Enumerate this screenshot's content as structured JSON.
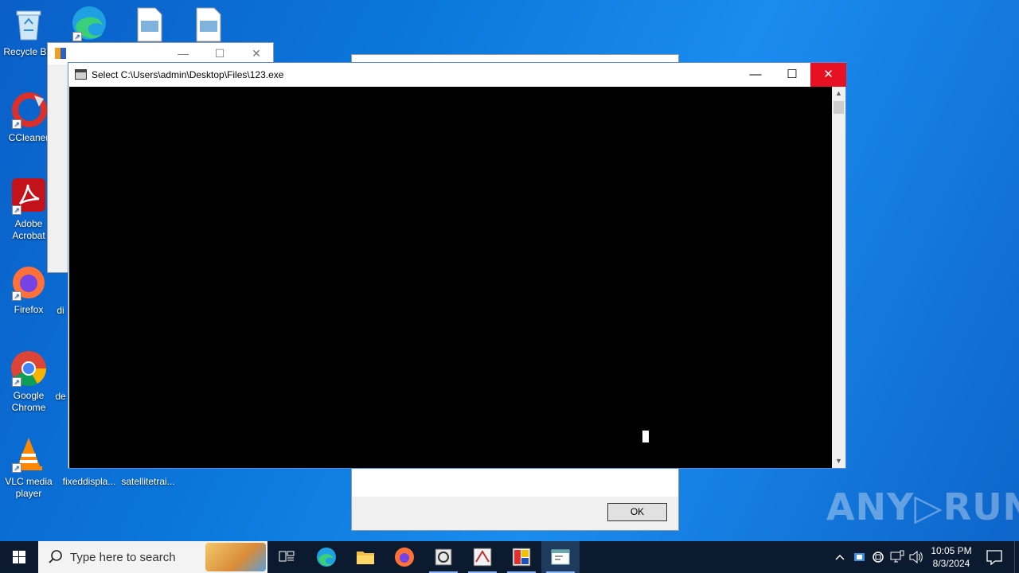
{
  "desktop": {
    "icons": [
      {
        "label": "Recycle Bin",
        "icon": "recycle-bin-icon"
      },
      {
        "label": "CCleaner",
        "icon": "ccleaner-icon"
      },
      {
        "label": "Adobe Acrobat",
        "icon": "adobe-acrobat-icon"
      },
      {
        "label": "Firefox",
        "icon": "firefox-icon"
      },
      {
        "label": "Google Chrome",
        "icon": "chrome-icon"
      },
      {
        "label": "VLC media player",
        "icon": "vlc-icon"
      },
      {
        "label": "fixeddispla...",
        "icon": "file-icon"
      },
      {
        "label": "satellitetrai...",
        "icon": "file-icon"
      },
      {
        "label": "di",
        "icon": "file-icon"
      },
      {
        "label": "de",
        "icon": "file-icon"
      }
    ]
  },
  "console_window": {
    "title": "Select C:\\Users\\admin\\Desktop\\Files\\123.exe",
    "minimize": "—",
    "maximize": "☐",
    "close": "✕"
  },
  "background_dialog": {
    "ok_label": "OK"
  },
  "small_window": {
    "minimize": "—",
    "maximize": "☐",
    "close": "✕"
  },
  "watermark": "ANY▷RUN",
  "taskbar": {
    "search_placeholder": "Type here to search",
    "apps": [
      "task-view-icon",
      "edge-icon",
      "file-explorer-icon",
      "firefox-icon",
      "app-icon",
      "app-icon",
      "app-icon",
      "console-icon"
    ],
    "tray": {
      "chevron": "^",
      "time": "10:05 PM",
      "date": "8/3/2024"
    }
  },
  "colors": {
    "close_red": "#e81123",
    "taskbar": "#0b1a2e",
    "desktop_blue": "#0b78dc"
  }
}
